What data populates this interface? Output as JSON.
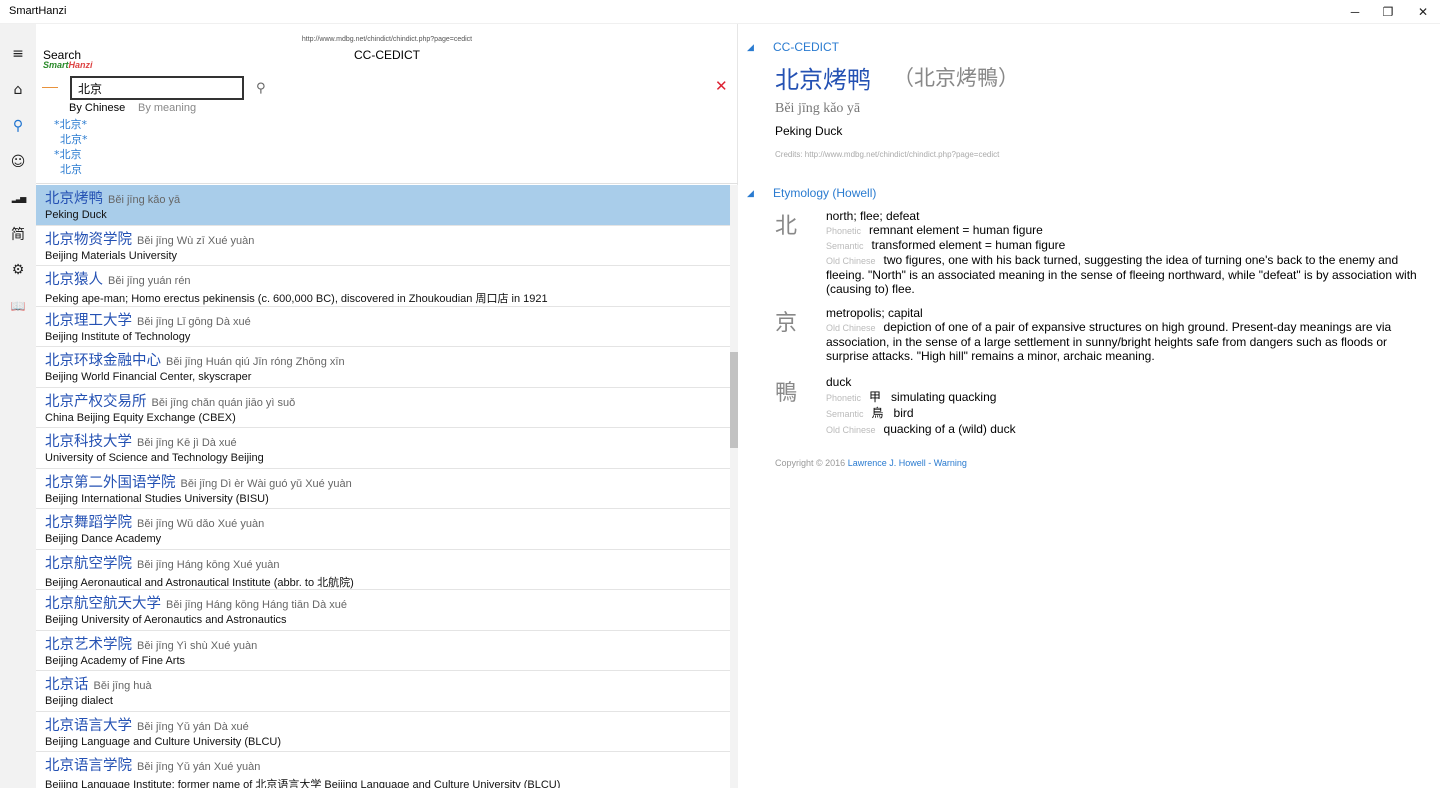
{
  "window": {
    "title": "SmartHanzi",
    "minimize": "─",
    "maximize": "❐",
    "close": "✕"
  },
  "nav": {
    "items": [
      {
        "name": "menu-icon",
        "glyph": "≡"
      },
      {
        "name": "home-icon",
        "glyph": "⌂"
      },
      {
        "name": "search-icon",
        "glyph": "⚲"
      },
      {
        "name": "smiley-icon",
        "glyph": "☺"
      },
      {
        "name": "signal-bars-icon",
        "glyph": "▂▃▅"
      },
      {
        "name": "simplified-char-icon",
        "glyph": "简"
      },
      {
        "name": "settings-icon",
        "glyph": "⚙"
      },
      {
        "name": "book-icon",
        "glyph": "📖"
      }
    ]
  },
  "search": {
    "title": "Search",
    "brand_a": "Smart",
    "brand_b": "Hanzi",
    "source_url": "http://www.mdbg.net/chindict/chindict.php?page=cedict",
    "source_name": "CC-CEDICT",
    "query": "北京",
    "mag_glyph": "⚲",
    "clear_glyph": "✕",
    "mode_chinese": "By Chinese",
    "mode_meaning": "By meaning",
    "suggestions": [
      "*北京*",
      "北京*",
      "*北京",
      "北京"
    ]
  },
  "results": [
    {
      "hz": "北京烤鸭",
      "py": "Běi jīng kǎo yā",
      "def": "Peking Duck"
    },
    {
      "hz": "北京物资学院",
      "py": "Běi jīng Wù zī Xué yuàn",
      "def": "Beijing Materials University"
    },
    {
      "hz": "北京猿人",
      "py": "Běi jīng yuán rén",
      "def": "Peking ape-man; Homo erectus pekinensis (c. 600,000 BC), discovered in Zhoukoudian 周口店 in 1921"
    },
    {
      "hz": "北京理工大学",
      "py": "Běi jīng Lǐ gōng Dà xué",
      "def": "Beijing Institute of Technology"
    },
    {
      "hz": "北京环球金融中心",
      "py": "Běi jīng Huán qiú Jīn róng Zhōng xīn",
      "def": "Beijing World Financial Center, skyscraper"
    },
    {
      "hz": "北京产权交易所",
      "py": "Běi jīng chǎn quán jiāo yì suǒ",
      "def": "China Beijing Equity Exchange (CBEX)"
    },
    {
      "hz": "北京科技大学",
      "py": "Běi jīng Kē jì Dà xué",
      "def": "University of Science and Technology Beijing"
    },
    {
      "hz": "北京第二外国语学院",
      "py": "Běi jīng Dì èr Wài guó yǔ Xué yuàn",
      "def": "Beijing International Studies University (BISU)"
    },
    {
      "hz": "北京舞蹈学院",
      "py": "Běi jīng Wǔ dǎo Xué yuàn",
      "def": "Beijing Dance Academy"
    },
    {
      "hz": "北京航空学院",
      "py": "Běi jīng Háng kōng Xué yuàn",
      "def": "Beijing Aeronautical and Astronautical Institute (abbr. to 北航院)"
    },
    {
      "hz": "北京航空航天大学",
      "py": "Běi jīng Háng kōng Háng tiān Dà xué",
      "def": "Beijing University of Aeronautics and Astronautics"
    },
    {
      "hz": "北京艺术学院",
      "py": "Běi jīng Yì shù Xué yuàn",
      "def": "Beijing Academy of Fine Arts"
    },
    {
      "hz": "北京话",
      "py": "Běi jīng huà",
      "def": "Beijing dialect"
    },
    {
      "hz": "北京语言大学",
      "py": "Běi jīng Yǔ yán Dà xué",
      "def": "Beijing Language and Culture University (BLCU)"
    },
    {
      "hz": "北京语言学院",
      "py": "Běi jīng Yǔ yán Xué yuàn",
      "def": "Beijing Language Institute; former name of 北京语言大学 Beijing Language and Culture University (BLCU)"
    }
  ],
  "detail": {
    "dict_title": "CC-CEDICT",
    "word_simplified": "北京烤鸭",
    "word_traditional": "（北京烤鴨）",
    "pinyin": "Běi jīng kǎo yā",
    "definition": "Peking Duck",
    "credits": "Credits: http://www.mdbg.net/chindict/chindict.php?page=cedict",
    "tri_glyph": "◢",
    "etym_title": "Etymology (Howell)",
    "etym": [
      {
        "char": "北",
        "meaning": "north; flee; defeat",
        "phonetic_label": "Phonetic",
        "phonetic": "remnant element = human figure",
        "semantic_label": "Semantic",
        "semantic": "transformed element = human figure",
        "old_label": "Old Chinese",
        "old": "two figures, one with his back turned, suggesting the idea of turning one's back to the enemy and fleeing. \"North\" is an associated meaning in the sense of fleeing northward, while \"defeat\" is by association with (causing to) flee."
      },
      {
        "char": "京",
        "meaning": "metropolis; capital",
        "old_label": "Old Chinese",
        "old": "depiction of one of a pair of expansive structures on high ground. Present-day meanings are via association, in the sense of a large settlement in sunny/bright heights safe from dangers such as floods or surprise attacks. \"High hill\" remains a minor, archaic meaning."
      },
      {
        "char": "鴨",
        "meaning": "duck",
        "phonetic_label": "Phonetic",
        "phonetic_hz": "甲",
        "phonetic": "simulating quacking",
        "semantic_label": "Semantic",
        "semantic_hz": "鳥",
        "semantic": "bird",
        "old_label": "Old Chinese",
        "old": "quacking of a (wild) duck"
      }
    ],
    "copyright_prefix": "Copyright © 2016 ",
    "copyright_link": "Lawrence J. Howell - Warning"
  }
}
